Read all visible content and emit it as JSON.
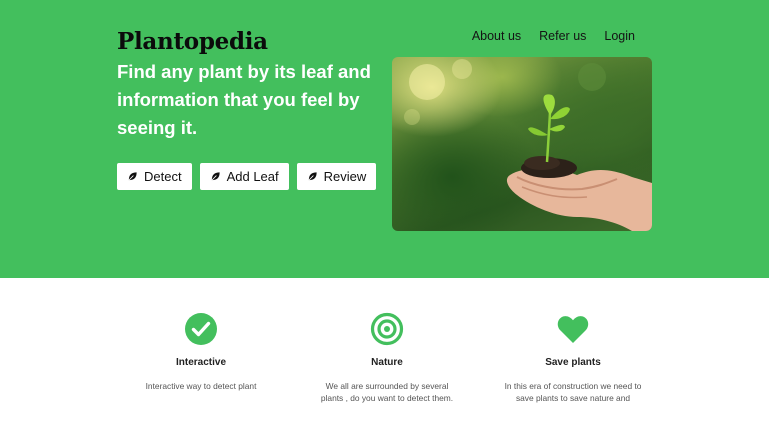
{
  "brand": {
    "name": "Plantopedia"
  },
  "nav": {
    "items": [
      "About us",
      "Refer us",
      "Login"
    ]
  },
  "hero": {
    "headline": "Find any plant by its leaf and information that you feel by seeing it.",
    "buttons": [
      {
        "label": "Detect",
        "icon": "leaf-icon"
      },
      {
        "label": "Add Leaf",
        "icon": "leaf-icon"
      },
      {
        "label": "Review",
        "icon": "leaf-icon"
      }
    ],
    "image": {
      "subject": "seedling-in-hands"
    }
  },
  "features": [
    {
      "icon": "check-circle-icon",
      "title": "Interactive",
      "text": "Interactive way to detect plant"
    },
    {
      "icon": "target-icon",
      "title": "Nature",
      "text": "We all are surrounded by several plants , do you want to detect them."
    },
    {
      "icon": "heart-icon",
      "title": "Save plants",
      "text": "In this era of construction we need to save plants to save nature and"
    }
  ],
  "colors": {
    "accent": "#43bf5d",
    "text_dark": "#141414",
    "white": "#ffffff"
  }
}
